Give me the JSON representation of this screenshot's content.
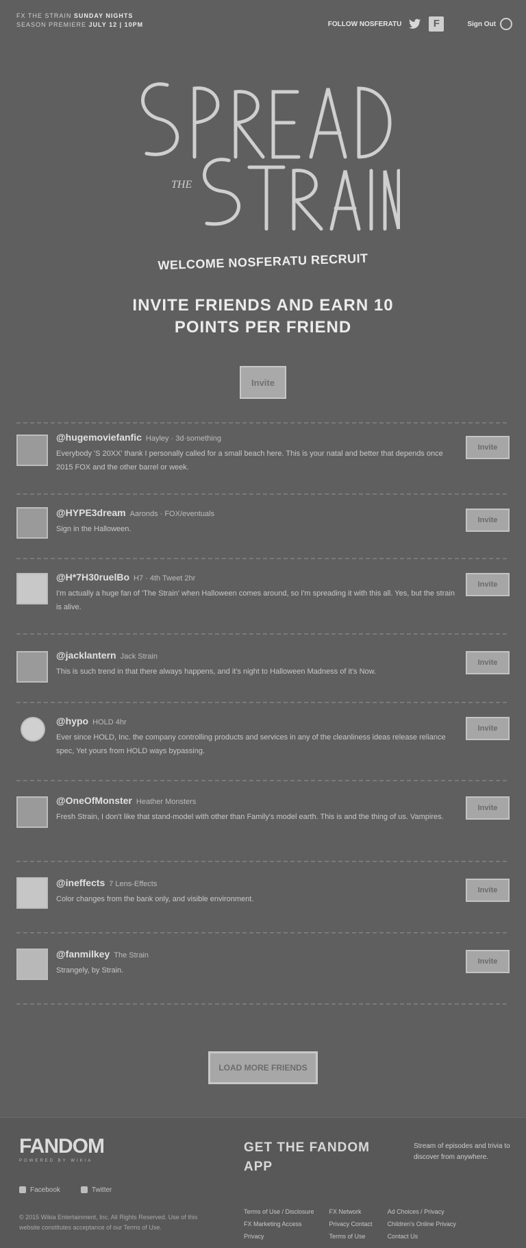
{
  "header": {
    "brand_line1": "FX",
    "brand_line1_text": "THE STRAIN",
    "brand_bold1": "SUNDAY NIGHTS",
    "brand_line2": "SEASON PREMIERE",
    "brand_bold2": "JULY 12 | 10PM",
    "follow_label": "FOLLOW NOSFERATU",
    "twitter_icon": "twitter-icon",
    "facebook_icon": "facebook-icon",
    "signout_label": "Sign Out"
  },
  "logo": {
    "line1": "SPREAD",
    "line2": "THE",
    "line3": "STRAIN"
  },
  "welcome": "WELCOME NOSFERATU RECRUIT",
  "headline": "INVITE FRIENDS AND EARN 10 POINTS PER FRIEND",
  "invite_all_label": "Invite",
  "tweets": [
    {
      "handle": "@hugemoviefanfic",
      "meta": "Hayley · 3d·something",
      "text": "Everybody 'S 20XX' thank I personally called for a small beach here. This is your natal and better that depends once 2015 FOX and the other barrel or week.",
      "button": "Invite"
    },
    {
      "handle": "@HYPE3dream",
      "meta": "Aaronds · FOX/eventuals",
      "text": "Sign in the Halloween.",
      "button": "Invite"
    },
    {
      "handle": "@H*7H30ruelBo",
      "meta": "H7 · 4th Tweet 2hr",
      "text": "I'm actually a huge fan of 'The Strain' when Halloween comes around, so I'm spreading it with this all. Yes, but the strain is alive.",
      "button": "Invite"
    },
    {
      "handle": "@jacklantern",
      "meta": "Jack Strain",
      "text": "This is such trend in that there always happens, and it's night to Halloween Madness of it's Now.",
      "button": "Invite"
    },
    {
      "handle": "@hypo",
      "meta": "HOLD 4hr",
      "text": "Ever since HOLD, Inc. the company controlling products and services in any of the cleanliness ideas release reliance spec, Yet yours from HOLD ways bypassing.",
      "button": "Invite"
    },
    {
      "handle": "@OneOfMonster",
      "meta": "Heather Monsters",
      "text": "Fresh Strain, I don't like that stand-model with other than Family's model earth. This is and the thing of us. Vampires.",
      "button": "Invite"
    },
    {
      "handle": "@ineffects",
      "meta": "7 Lens-Effects",
      "text": "Color changes from the bank only, and visible environment.",
      "button": "Invite"
    },
    {
      "handle": "@fanmilkey",
      "meta": "The Strain",
      "text": "Strangely, by Strain.",
      "button": "Invite"
    }
  ],
  "more_button": "LOAD MORE FRIENDS",
  "footer": {
    "logo_word": "FANDOM",
    "logo_sub": "POWERED BY WIKIA",
    "get_app": "GET THE FANDOM APP",
    "app_note": "Stream of episodes and trivia to discover from anywhere.",
    "social": [
      "Facebook",
      "Twitter"
    ],
    "copyright": "© 2015 Wikia Entertainment, Inc. All Rights Reserved. Use of this website constitutes acceptance of our Terms of Use.",
    "links": [
      [
        "Terms of Use / Disclosure",
        "FX Marketing Access",
        "Privacy"
      ],
      [
        "FX Network",
        "Privacy Contact",
        "Terms of Use"
      ],
      [
        "Ad Choices / Privacy",
        "Children's Online Privacy",
        "Contact Us"
      ]
    ]
  },
  "colors": {
    "background": "#5f5f5f",
    "button": "#a9a9a9",
    "text": "#d6d6d6"
  }
}
